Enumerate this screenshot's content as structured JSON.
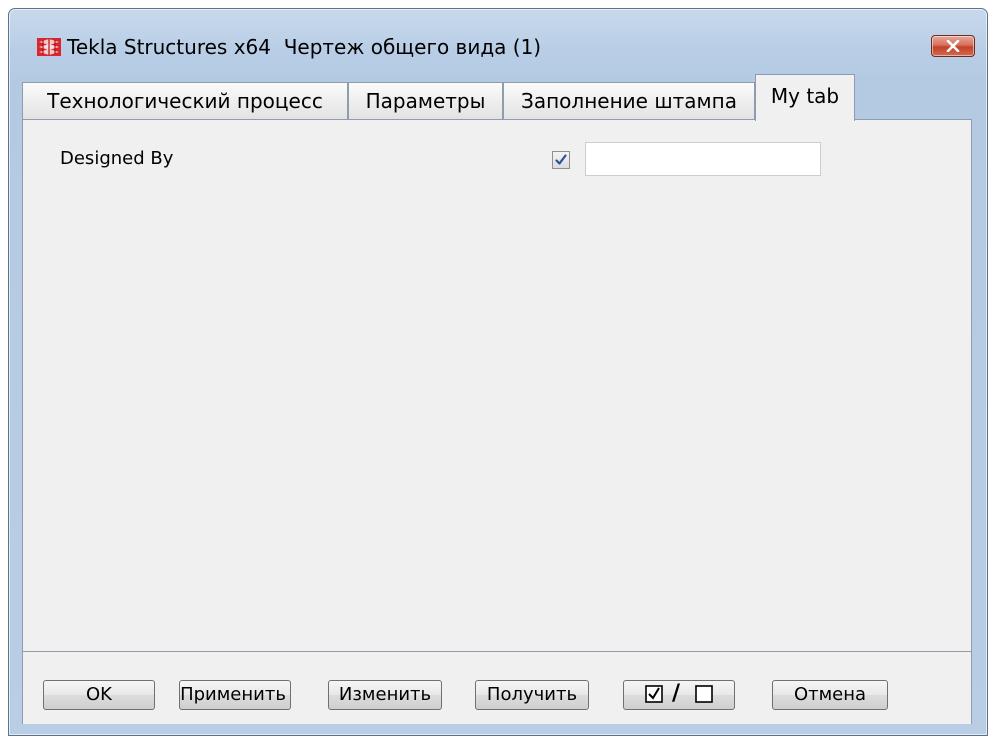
{
  "window": {
    "title": "Tekla Structures x64  Чертеж общего вида (1)",
    "icon": "tekla-logo-icon",
    "accent_close": "#c94b33"
  },
  "tabs": [
    {
      "label": "Технологический процесс",
      "active": false
    },
    {
      "label": "Параметры",
      "active": false
    },
    {
      "label": "Заполнение штампа",
      "active": false
    },
    {
      "label": "My tab",
      "active": true
    }
  ],
  "form": {
    "designed_by": {
      "label": "Designed By",
      "checked": true,
      "value": "",
      "placeholder": ""
    }
  },
  "buttons": {
    "ok": "OK",
    "apply": "Применить",
    "modify": "Изменить",
    "get": "Получить",
    "toggle_sep": "/",
    "cancel": "Отмена"
  }
}
